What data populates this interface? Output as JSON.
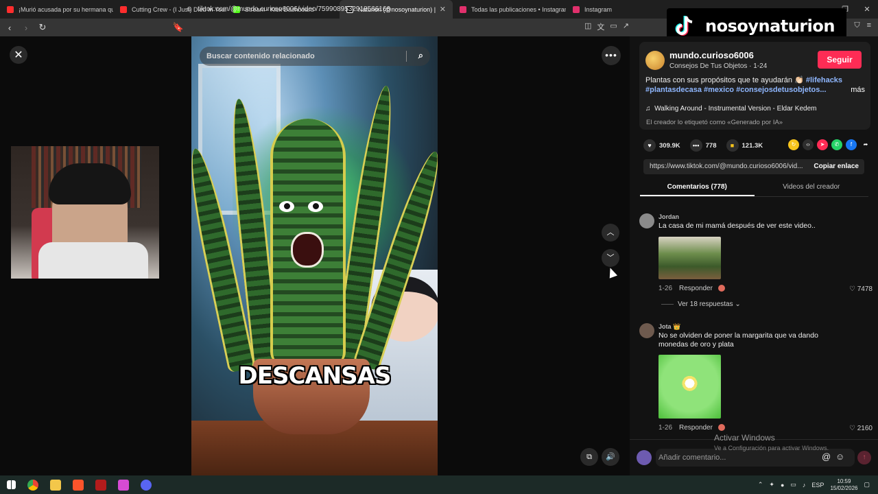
{
  "browser": {
    "tabs": [
      {
        "label": "¡Murió acusada por su hermana que",
        "color": "#ff2d2d",
        "active": false
      },
      {
        "label": "Cutting Crew - (I Just) Died In Your A",
        "color": "#ff2d2d",
        "active": false
      },
      {
        "label": "Stream - Kick Dashboard",
        "color": "#53fc18",
        "active": false
      },
      {
        "label": "Naturion (@nosoynaturion) |",
        "color": "#ffffff",
        "active": true
      },
      {
        "label": "Todas las publicaciones • Instagram",
        "color": "#e1306c",
        "active": false
      },
      {
        "label": "Instagram",
        "color": "#e1306c",
        "active": false
      }
    ],
    "url": "tiktok.com/@mundo.curioso6006/video/7599089532918566166"
  },
  "overlay": {
    "channel_name": "nosoynaturion"
  },
  "video": {
    "search_placeholder": "Buscar contenido relacionado",
    "caption": "DESCANSAS"
  },
  "panel": {
    "username": "mundo.curioso6006",
    "subtitle": "Consejos De Tus Objetos · 1-24",
    "follow_label": "Seguir",
    "description_text": "Plantas con sus propósitos que te ayudarán 👏🏻 ",
    "description_tags": [
      "#lifehacks",
      "#plantasdecasa",
      "#mexico",
      "#consejosdetusobjetos..."
    ],
    "more_label": "más",
    "music": "Walking Around - Instrumental Version - Eldar Kedem",
    "ai_note": "El creador lo etiquetó como «Generado por IA»",
    "likes": "309.9K",
    "comments_count": "778",
    "saves": "121.3K",
    "link": "https://www.tiktok.com/@mundo.curioso6006/vid...",
    "copy_label": "Copiar enlace",
    "tab_comments": "Comentarios (778)",
    "tab_videos": "Videos del creador"
  },
  "comments": [
    {
      "user": "Jordan",
      "text": "La casa de mi mamá después de ver este video..",
      "date": "1-26",
      "reply_label": "Responder",
      "likes": "7478",
      "replies_label": "Ver 18 respuestas"
    },
    {
      "user": "Jota 👑",
      "text": "No se olviden de poner la margarita que va dando monedas de oro y plata",
      "date": "1-26",
      "reply_label": "Responder",
      "likes": "2160"
    }
  ],
  "comment_input": {
    "placeholder": "Añadir comentario..."
  },
  "windows_watermark": {
    "title": "Activar Windows",
    "subtitle": "Ve a Configuración para activar Windows."
  },
  "taskbar": {
    "language": "ESP",
    "time": "10:59",
    "date": "15/02/2026"
  }
}
